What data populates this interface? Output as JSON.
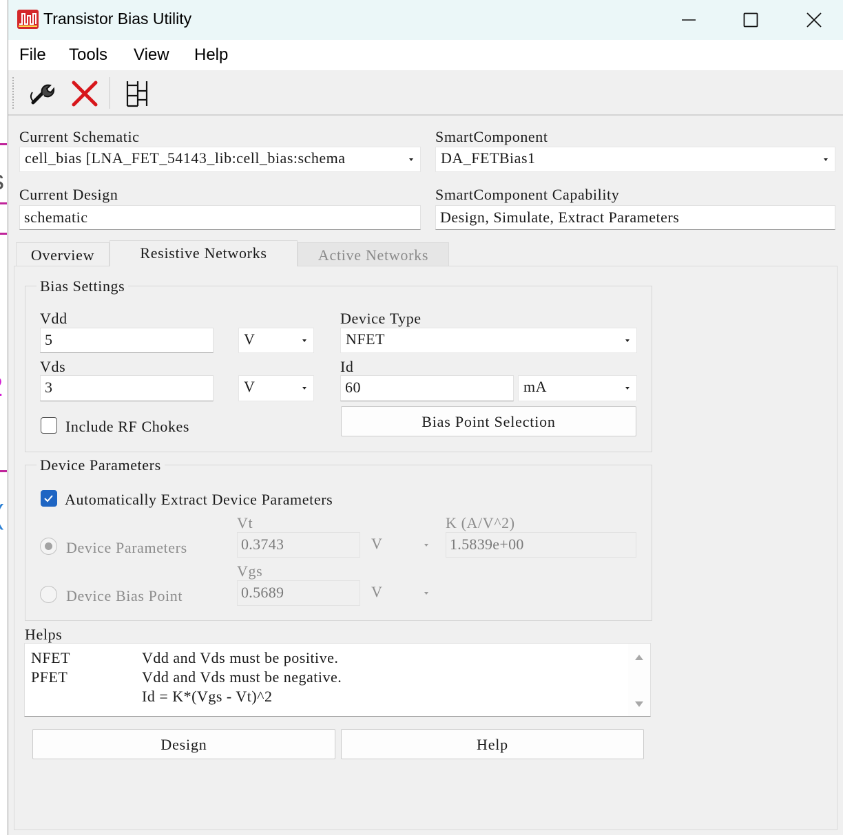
{
  "window": {
    "title": "Transistor Bias Utility",
    "controls": {
      "minimize": "minimize-icon",
      "maximize": "maximize-icon",
      "close": "close-icon"
    }
  },
  "menu": [
    "File",
    "Tools",
    "View",
    "Help"
  ],
  "toolbar": {
    "tools": [
      "wrench-icon",
      "delete-x-icon",
      "grid-layout-icon"
    ]
  },
  "background_glimpse": [
    "s",
    "2",
    "("
  ],
  "schematic": {
    "label": "Current Schematic",
    "value": "cell_bias [LNA_FET_54143_lib:cell_bias:schema"
  },
  "smart_component": {
    "label": "SmartComponent",
    "value": "DA_FETBias1"
  },
  "design": {
    "label": "Current Design",
    "value": "schematic"
  },
  "capability": {
    "label": "SmartComponent Capability",
    "value": "Design, Simulate, Extract Parameters"
  },
  "tabs": [
    {
      "label": "Overview",
      "state": "normal"
    },
    {
      "label": "Resistive Networks",
      "state": "active"
    },
    {
      "label": "Active Networks",
      "state": "disabled"
    }
  ],
  "bias_settings": {
    "title": "Bias Settings",
    "vdd": {
      "label": "Vdd",
      "value": "5",
      "unit": "V"
    },
    "vds": {
      "label": "Vds",
      "value": "3",
      "unit": "V"
    },
    "device_type": {
      "label": "Device Type",
      "value": "NFET"
    },
    "id": {
      "label": "Id",
      "value": "60",
      "unit": "mA"
    },
    "rf_chokes": {
      "label": "Include RF Chokes",
      "checked": false
    },
    "bias_point_button": "Bias Point Selection"
  },
  "device_parameters": {
    "title": "Device Parameters",
    "auto_extract": {
      "label": "Automatically Extract Device Parameters",
      "checked": true
    },
    "radio_params": {
      "label": "Device Parameters",
      "selected": true
    },
    "radio_bias": {
      "label": "Device Bias Point",
      "selected": false
    },
    "vt": {
      "label": "Vt",
      "value": "0.3743",
      "unit": "V"
    },
    "k": {
      "label": "K (A/V^2)",
      "value": "1.5839e+00"
    },
    "vgs": {
      "label": "Vgs",
      "value": "0.5689",
      "unit": "V"
    }
  },
  "helps": {
    "label": "Helps",
    "lines": [
      {
        "key": "NFET",
        "text": "Vdd and Vds must be positive."
      },
      {
        "key": "PFET",
        "text": "Vdd and Vds must be negative."
      },
      {
        "key": "",
        "text": "Id = K*(Vgs - Vt)^2"
      }
    ]
  },
  "buttons": {
    "design": "Design",
    "help": "Help"
  }
}
